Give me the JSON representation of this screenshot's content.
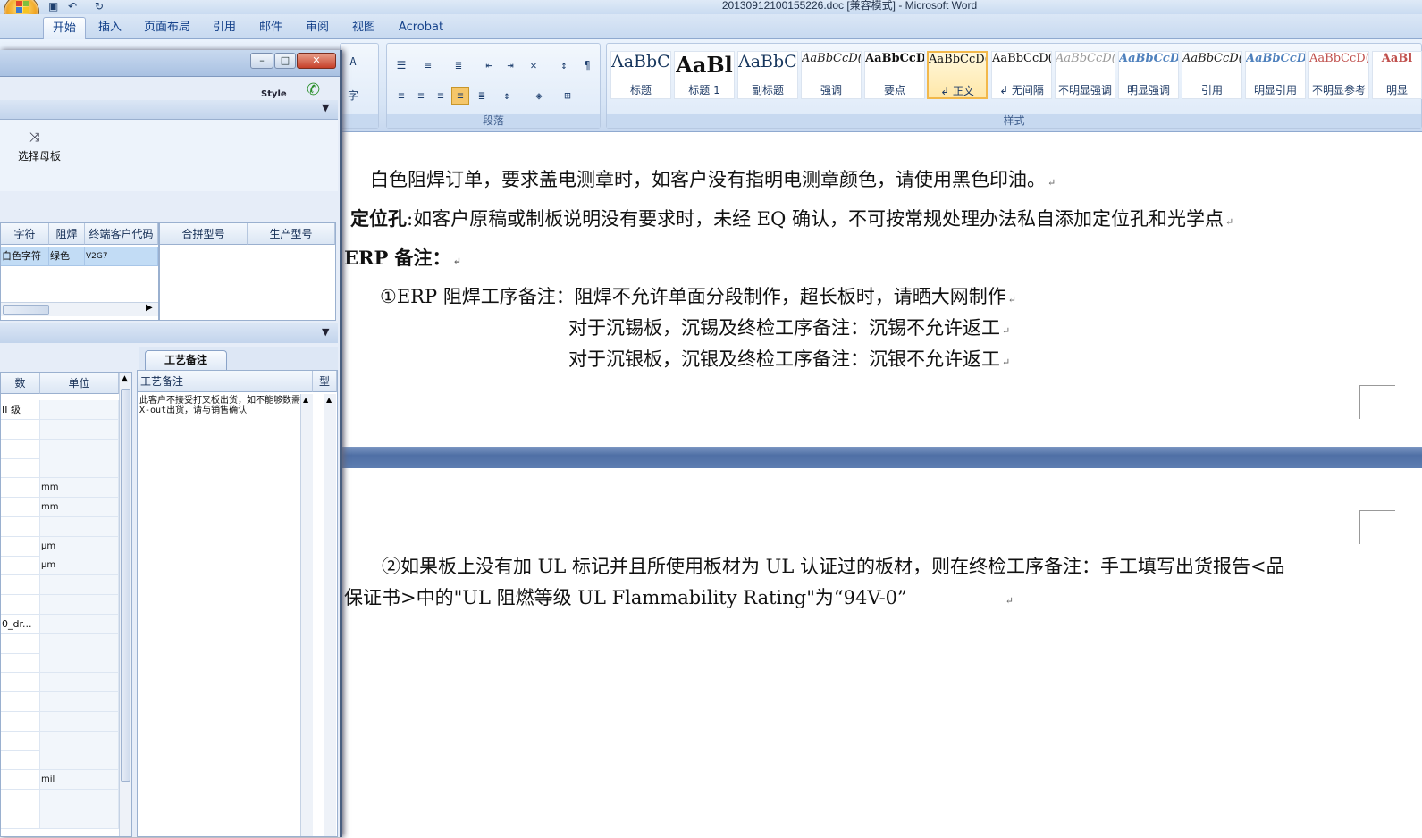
{
  "window": {
    "title": "20130912100155226.doc [兼容模式] - Microsoft Word"
  },
  "tabs": [
    "开始",
    "插入",
    "页面布局",
    "引用",
    "邮件",
    "审阅",
    "视图",
    "Acrobat"
  ],
  "ribbon": {
    "paragraph_label": "段落",
    "styles_label": "样式",
    "styles": [
      {
        "sample": "AaBbC(",
        "label": "标题"
      },
      {
        "sample": "AaBl",
        "label": "标题 1"
      },
      {
        "sample": "AaBbC(",
        "label": "副标题"
      },
      {
        "sample": "AaBbCcD(",
        "label": "强调"
      },
      {
        "sample": "AaBbCcD",
        "label": "要点"
      },
      {
        "sample": "AaBbCcD(",
        "label": "↲ 正文"
      },
      {
        "sample": "AaBbCcD(",
        "label": "↲ 无间隔"
      },
      {
        "sample": "AaBbCcD(",
        "label": "不明显强调"
      },
      {
        "sample": "AaBbCcD(",
        "label": "明显强调"
      },
      {
        "sample": "AaBbCcD(",
        "label": "引用"
      },
      {
        "sample": "AaBbCcD(",
        "label": "明显引用"
      },
      {
        "sample": "AaBbCcD(",
        "label": "不明显参考"
      },
      {
        "sample": "AaBl",
        "label": "明显"
      }
    ]
  },
  "document": {
    "line1": "白色阻焊订单，要求盖电测章时，如客户没有指明电测章颜色，请使用黑色印油。",
    "line2_bold": "定位孔",
    "line2": ":如客户原稿或制板说明没有要求时，未经 EQ 确认，不可按常规处理办法私自添加定位孔和光学点",
    "line3": "ERP 备注：",
    "line4": "①ERP 阻焊工序备注：阻焊不允许单面分段制作，超长板时，请晒大网制作",
    "line5": "对于沉锡板，沉锡及终检工序备注：沉锡不允许返工",
    "line6": "对于沉银板，沉银及终检工序备注：沉银不允许返工",
    "line7": "②如果板上没有加 UL 标记并且所使用板材为 UL 认证过的板材，则在终检工序备注：手工填写出货报告<品",
    "line8": "保证书>中的\"UL 阻燃等级 UL Flammability Rating\"为“94V-0”"
  },
  "dialog": {
    "style_label": "Style",
    "select_master": "选择母板",
    "grid1": {
      "headers": [
        "字符",
        "阻焊",
        "终端客户代码",
        "合拼型号",
        "生产型号"
      ],
      "row": [
        "白色字符",
        "绿色",
        "V2G7"
      ]
    },
    "tab_process_note": "工艺备注",
    "grid2": {
      "headers": [
        "数",
        "单位"
      ],
      "rows": [
        [
          "II 级",
          ""
        ],
        [
          "",
          ""
        ],
        [
          "",
          ""
        ],
        [
          "",
          ""
        ],
        [
          "",
          "mm"
        ],
        [
          "",
          "mm"
        ],
        [
          "",
          ""
        ],
        [
          "",
          "μm"
        ],
        [
          "",
          "μm"
        ],
        [
          "",
          ""
        ],
        [
          "",
          ""
        ],
        [
          "0_dr...",
          ""
        ],
        [
          "",
          ""
        ],
        [
          "",
          ""
        ],
        [
          "",
          ""
        ],
        [
          "",
          ""
        ],
        [
          "",
          ""
        ],
        [
          "",
          ""
        ],
        [
          "",
          ""
        ],
        [
          "",
          "mil"
        ],
        [
          "",
          ""
        ],
        [
          "",
          ""
        ]
      ]
    },
    "note_header": "工艺备注",
    "note_col2": "型",
    "note_text": "此客户不接受打叉板出货，如不能够数需X-out出货，请与销售确认"
  }
}
